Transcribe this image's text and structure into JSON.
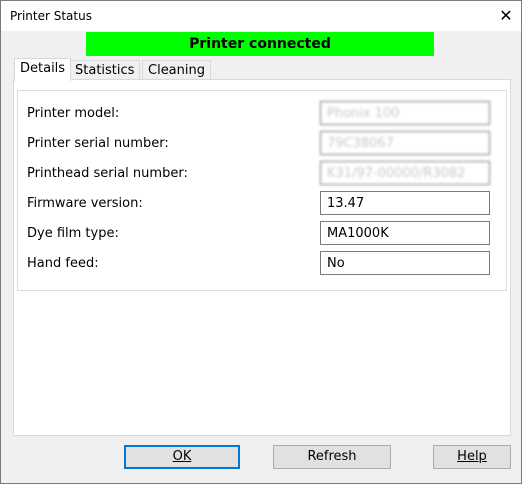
{
  "window": {
    "title": "Printer Status",
    "close_label": "✕"
  },
  "status": {
    "text": "Printer connected",
    "color": "#00ff00"
  },
  "tabs": [
    {
      "label": "Details",
      "active": true
    },
    {
      "label": "Statistics",
      "active": false
    },
    {
      "label": "Cleaning",
      "active": false
    }
  ],
  "details": {
    "rows": [
      {
        "label": "Printer model:",
        "value": "Phonix 100"
      },
      {
        "label": "Printer serial number:",
        "value": "79C38067"
      },
      {
        "label": "Printhead serial number:",
        "value": "K31/97-00000/R3082"
      },
      {
        "label": "Firmware version:",
        "value": "13.47"
      },
      {
        "label": "Dye film type:",
        "value": "MA1000K"
      },
      {
        "label": "Hand feed:",
        "value": "No"
      }
    ]
  },
  "buttons": {
    "ok_label": "OK",
    "refresh_label": "Refresh",
    "help_label": "Help"
  }
}
